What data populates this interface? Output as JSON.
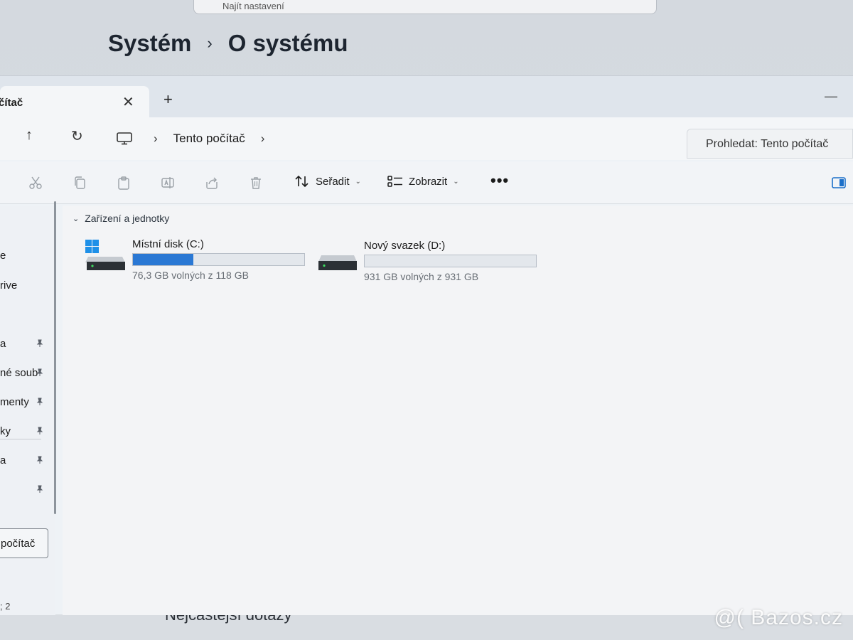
{
  "settings": {
    "search_text": "Najít nastavení",
    "breadcrumb_parent": "Systém",
    "breadcrumb_current": "O systému",
    "faq_text": "Nejčastější dotazy"
  },
  "watermark": "@( Bazos.cz",
  "explorer": {
    "tab_title": "čítač",
    "tab_close": "✕",
    "tab_add": "+",
    "address": {
      "location": "Tento počítač"
    },
    "search_placeholder": "Prohledat: Tento počítač",
    "toolbar": {
      "sort_label": "Seřadit",
      "view_label": "Zobrazit",
      "more_label": "•••"
    },
    "sidebar": {
      "items": [
        {
          "label": "e"
        },
        {
          "label": "rive"
        },
        {
          "label": "a",
          "pinned": true
        },
        {
          "label": "né soub",
          "pinned": true
        },
        {
          "label": "menty",
          "pinned": true
        },
        {
          "label": "ky",
          "pinned": true
        },
        {
          "label": "a",
          "pinned": true
        },
        {
          "label": "",
          "pinned": true
        }
      ],
      "selected_label": "počítač",
      "status": "; 2"
    },
    "group_title": "Zařízení a jednotky",
    "drives": [
      {
        "name": "Místní disk (C:)",
        "info": "76,3 GB volných z 118 GB",
        "used_fraction": 0.353,
        "icon": "windows-drive-icon"
      },
      {
        "name": "Nový svazek (D:)",
        "info": "931 GB volných z 931 GB",
        "used_fraction": 0.0,
        "icon": "drive-icon"
      }
    ]
  },
  "colors": {
    "accent": "#2a78d4"
  }
}
